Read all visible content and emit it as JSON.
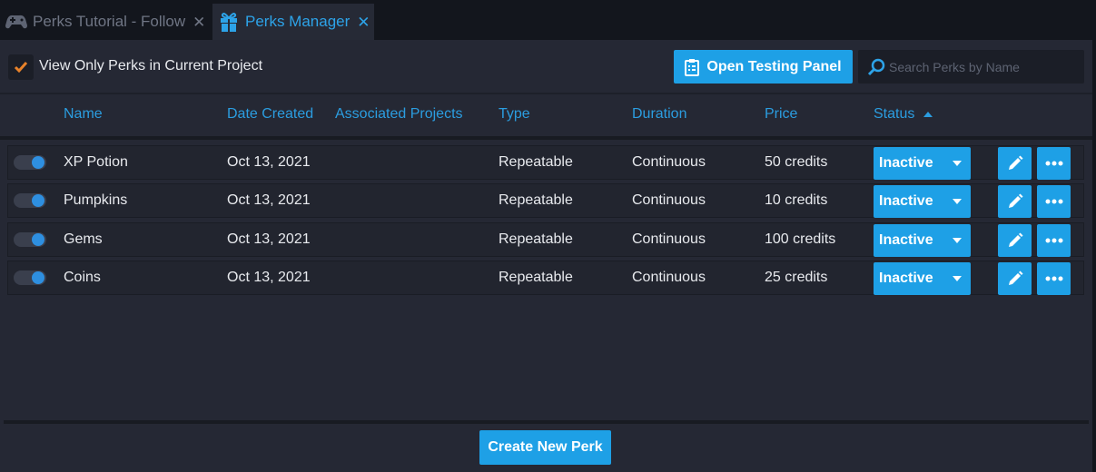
{
  "tabs": [
    {
      "label": "Perks Tutorial - Follow",
      "icon": "gamepad-icon",
      "close": "✕"
    },
    {
      "label": "Perks Manager",
      "icon": "gift-icon",
      "close": "✕"
    }
  ],
  "toolbar": {
    "checkbox_label": "View Only Perks in Current Project",
    "checkbox_checked": true,
    "open_testing_label": "Open Testing Panel",
    "search_placeholder": "Search Perks by Name"
  },
  "columns": {
    "name": "Name",
    "date_created": "Date Created",
    "associated_projects": "Associated Projects",
    "type": "Type",
    "duration": "Duration",
    "price": "Price",
    "status": "Status"
  },
  "perks": [
    {
      "name": "XP Potion",
      "date": "Oct 13, 2021",
      "projects": "",
      "type": "Repeatable",
      "duration": "Continuous",
      "price": "50 credits",
      "status": "Inactive",
      "enabled": true
    },
    {
      "name": "Pumpkins",
      "date": "Oct 13, 2021",
      "projects": "",
      "type": "Repeatable",
      "duration": "Continuous",
      "price": "10 credits",
      "status": "Inactive",
      "enabled": true
    },
    {
      "name": "Gems",
      "date": "Oct 13, 2021",
      "projects": "",
      "type": "Repeatable",
      "duration": "Continuous",
      "price": "100 credits",
      "status": "Inactive",
      "enabled": true
    },
    {
      "name": "Coins",
      "date": "Oct 13, 2021",
      "projects": "",
      "type": "Repeatable",
      "duration": "Continuous",
      "price": "25 credits",
      "status": "Inactive",
      "enabled": true
    }
  ],
  "footer": {
    "create_label": "Create New Perk"
  },
  "colors": {
    "accent": "#1ea0e6",
    "background": "#252834",
    "checkmark": "#e8822a"
  }
}
